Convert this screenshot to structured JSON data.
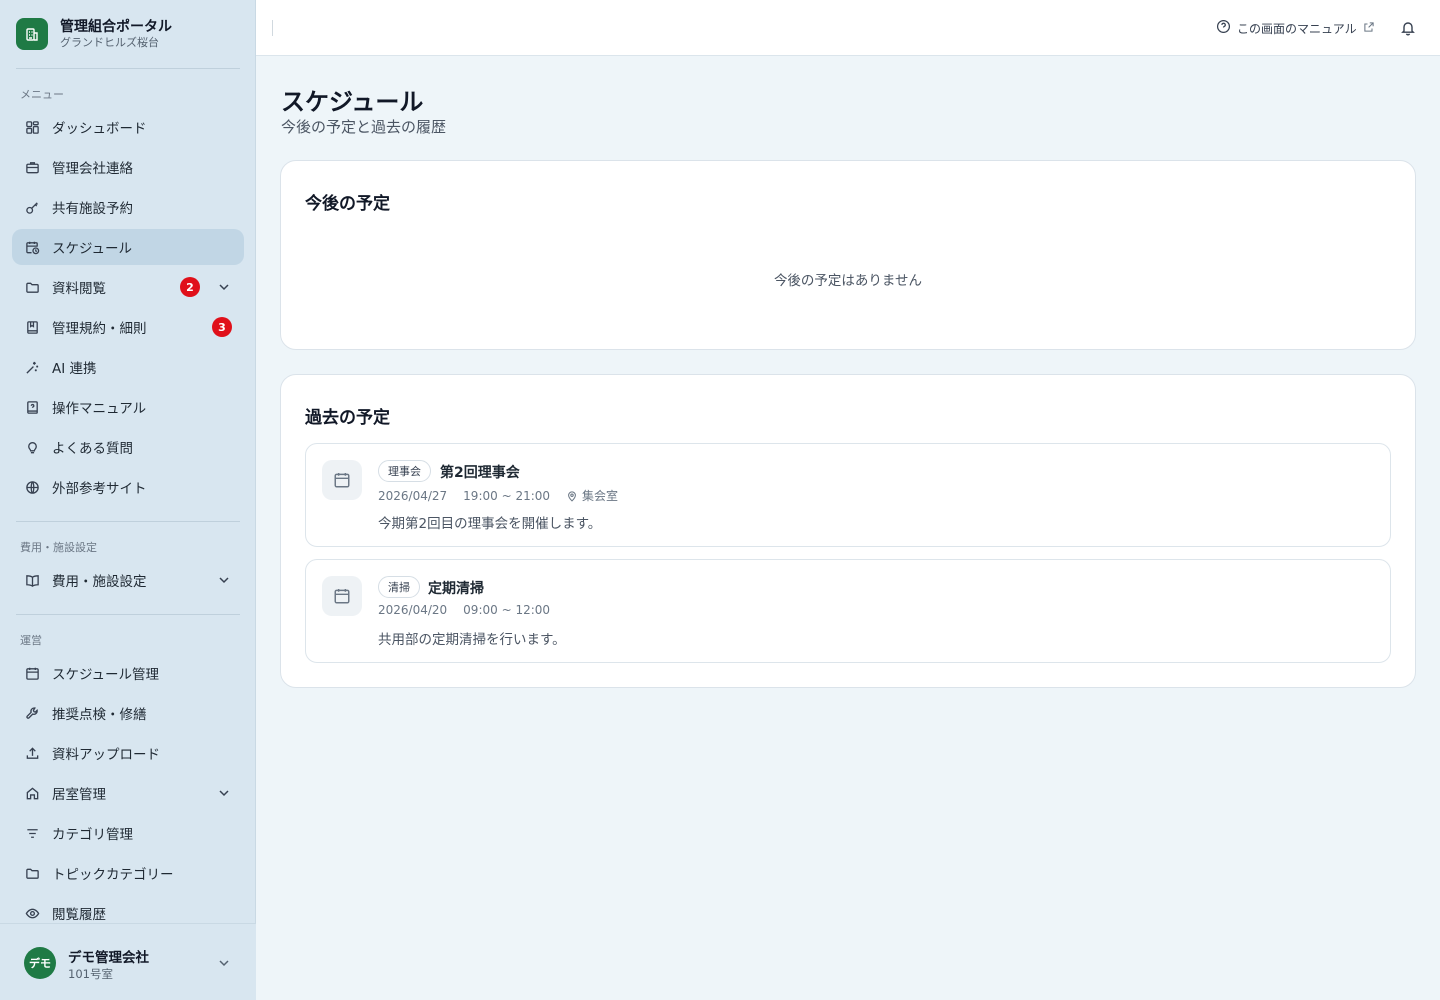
{
  "brand": {
    "title": "管理組合ポータル",
    "subtitle": "グランドヒルズ桜台"
  },
  "sidebar": {
    "sections": {
      "menu": "メニュー",
      "fees": "費用・施設設定",
      "ops": "運営"
    },
    "menu_items": [
      {
        "label": "ダッシュボード",
        "icon": "grid-icon"
      },
      {
        "label": "管理会社連絡",
        "icon": "briefcase-icon"
      },
      {
        "label": "共有施設予約",
        "icon": "key-icon"
      },
      {
        "label": "スケジュール",
        "icon": "calendar-clock-icon",
        "active": true
      },
      {
        "label": "資料閲覧",
        "icon": "folder-icon",
        "badge": "2",
        "expandable": true
      },
      {
        "label": "管理規約・細則",
        "icon": "book-icon",
        "badge": "3"
      },
      {
        "label": "AI 連携",
        "icon": "sparkle-icon"
      },
      {
        "label": "操作マニュアル",
        "icon": "manual-icon"
      },
      {
        "label": "よくある質問",
        "icon": "lightbulb-icon"
      },
      {
        "label": "外部参考サイト",
        "icon": "globe-icon"
      }
    ],
    "fees_items": [
      {
        "label": "費用・施設設定",
        "icon": "open-book-icon",
        "expandable": true
      }
    ],
    "ops_items": [
      {
        "label": "スケジュール管理",
        "icon": "calendar-icon"
      },
      {
        "label": "推奨点検・修繕",
        "icon": "wrench-icon"
      },
      {
        "label": "資料アップロード",
        "icon": "upload-icon"
      },
      {
        "label": "居室管理",
        "icon": "home-icon",
        "expandable": true
      },
      {
        "label": "カテゴリ管理",
        "icon": "filter-icon"
      },
      {
        "label": "トピックカテゴリー",
        "icon": "folder-icon"
      },
      {
        "label": "閲覧履歴",
        "icon": "eye-icon"
      }
    ]
  },
  "user": {
    "avatar": "デモ",
    "name": "デモ管理会社",
    "room": "101号室"
  },
  "topbar": {
    "manual_link": "この画面のマニュアル"
  },
  "page": {
    "title": "スケジュール",
    "subtitle": "今後の予定と過去の履歴"
  },
  "upcoming": {
    "title": "今後の予定",
    "empty": "今後の予定はありません"
  },
  "past": {
    "title": "過去の予定",
    "events": [
      {
        "tag": "理事会",
        "title": "第2回理事会",
        "date": "2026/04/27",
        "time": "19:00 ~ 21:00",
        "location": "集会室",
        "description": "今期第2回目の理事会を開催します。"
      },
      {
        "tag": "清掃",
        "title": "定期清掃",
        "date": "2026/04/20",
        "time": "09:00 ~ 12:00",
        "location": "",
        "description": "共用部の定期清掃を行います。"
      }
    ]
  },
  "colors": {
    "brand_green": "#1f7a45",
    "badge_red": "#e0101a",
    "sidebar_bg": "#d8e6f0",
    "active_bg": "#c1d6e5"
  }
}
